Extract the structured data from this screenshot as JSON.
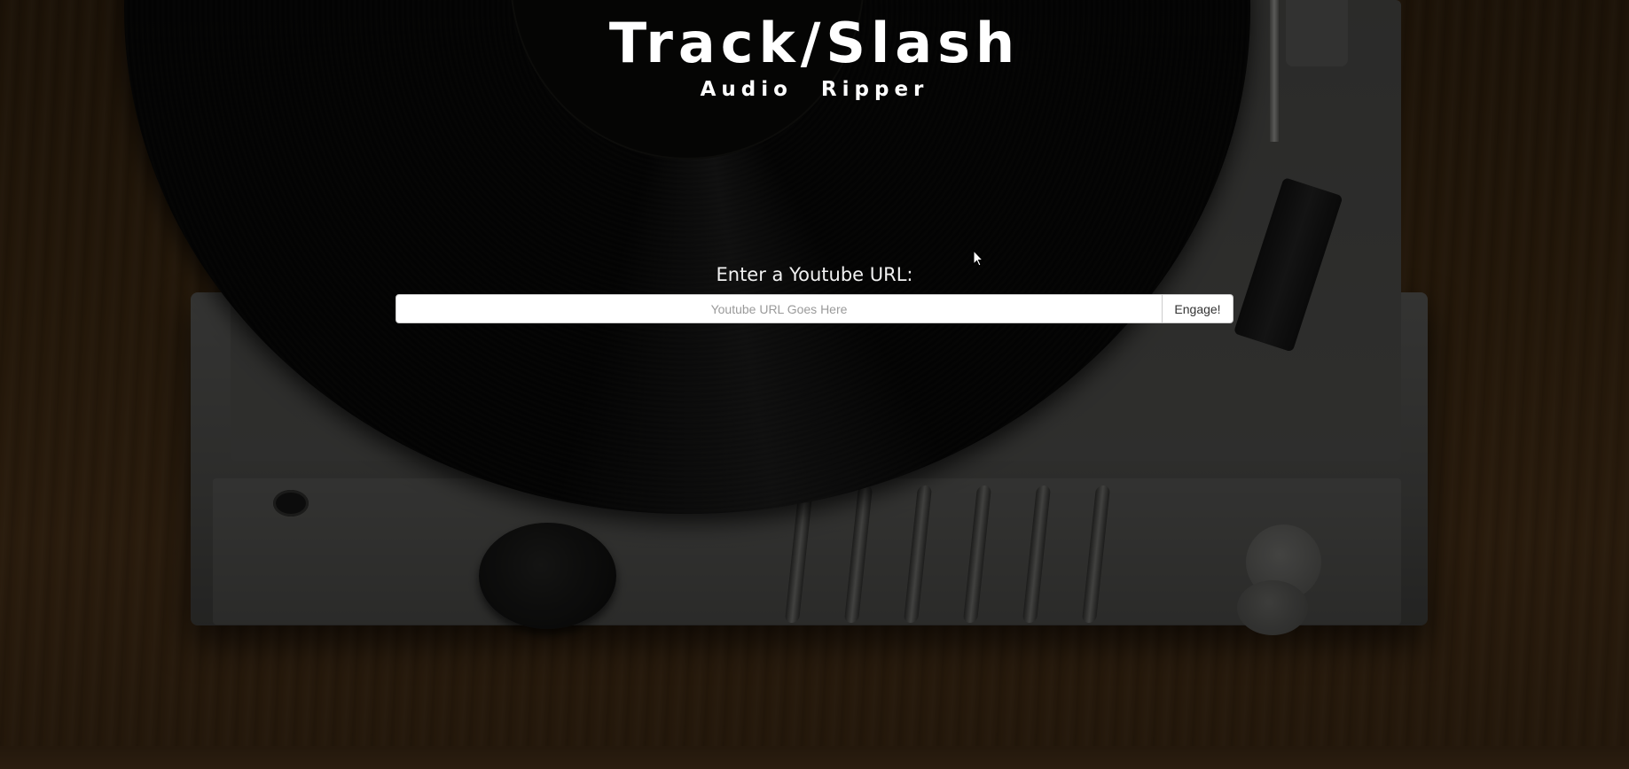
{
  "header": {
    "title": "Track/Slash",
    "subtitle": "Audio Ripper"
  },
  "form": {
    "prompt": "Enter a Youtube URL:",
    "url_value": "",
    "url_placeholder": "Youtube URL Goes Here",
    "submit_label": "Engage!"
  },
  "background": {
    "description_icon": "turntable-photo"
  }
}
